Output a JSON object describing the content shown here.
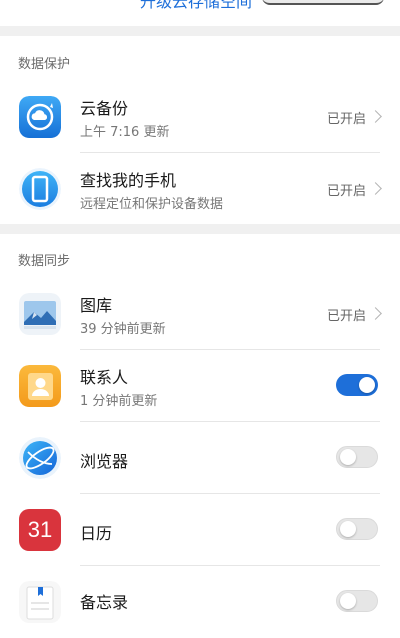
{
  "top": {
    "upgrade_link": "升级云存储空间"
  },
  "sections": {
    "protection": {
      "header": "数据保护"
    },
    "sync": {
      "header": "数据同步"
    }
  },
  "items": {
    "cloud_backup": {
      "title": "云备份",
      "subtitle": "上午 7:16 更新",
      "status": "已开启",
      "icon": "cloud-backup-icon"
    },
    "find_phone": {
      "title": "查找我的手机",
      "subtitle": "远程定位和保护设备数据",
      "status": "已开启",
      "icon": "phone-icon"
    },
    "gallery": {
      "title": "图库",
      "subtitle": "39 分钟前更新",
      "status": "已开启",
      "icon": "gallery-icon"
    },
    "contacts": {
      "title": "联系人",
      "subtitle": "1 分钟前更新",
      "toggle": true,
      "icon": "contacts-icon"
    },
    "browser": {
      "title": "浏览器",
      "toggle": false,
      "icon": "browser-icon"
    },
    "calendar": {
      "title": "日历",
      "toggle": false,
      "icon": "calendar-icon",
      "icon_text": "31"
    },
    "notes": {
      "title": "备忘录",
      "toggle": false,
      "icon": "notes-icon"
    }
  },
  "colors": {
    "accent": "#1e6fd9",
    "calendar": "#d9343d",
    "contacts": "#f5a623"
  }
}
